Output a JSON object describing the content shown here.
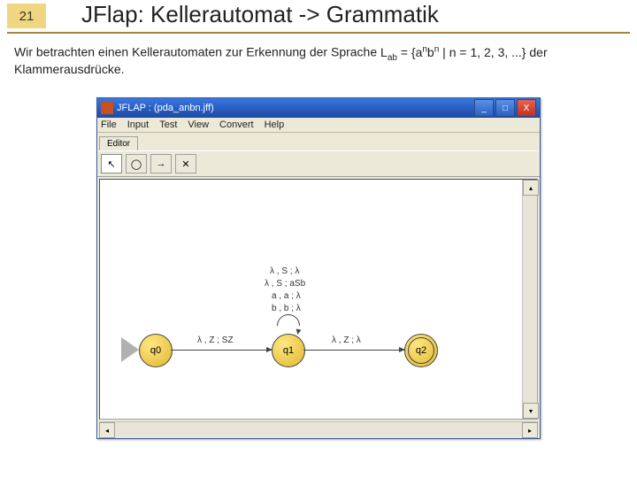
{
  "slide": {
    "number": "21",
    "title": "JFlap: Kellerautomat -> Grammatik",
    "body_pre": "Wir betrachten einen Kellerautomaten zur Erkennung der Sprache ",
    "body_lang": "L",
    "body_lang_sub": "ab",
    "body_eq": " = {a",
    "body_n1": "n",
    "body_b": "b",
    "body_n2": "n",
    "body_cond": " | n = 1, 2, 3, ...} der Klammerausdrücke."
  },
  "jflap": {
    "window_title": "JFLAP : (pda_anbn.jff)",
    "menu": [
      "File",
      "Input",
      "Test",
      "View",
      "Convert",
      "Help"
    ],
    "tab": "Editor",
    "tools": {
      "cursor": "↖",
      "state": "◯",
      "arrow": "→",
      "delete": "✕"
    },
    "states": {
      "q0": "q0",
      "q1": "q1",
      "q2": "q2"
    },
    "transitions": {
      "q0_q1": "λ , Z ; SZ",
      "q1_loop_1": "λ , S ; λ",
      "q1_loop_2": "λ , S ; aSb",
      "q1_loop_3": "a , a ; λ",
      "q1_loop_4": "b , b ; λ",
      "q1_q2": "λ , Z ; λ"
    },
    "win_min": "_",
    "win_max": "□",
    "win_close": "X"
  }
}
